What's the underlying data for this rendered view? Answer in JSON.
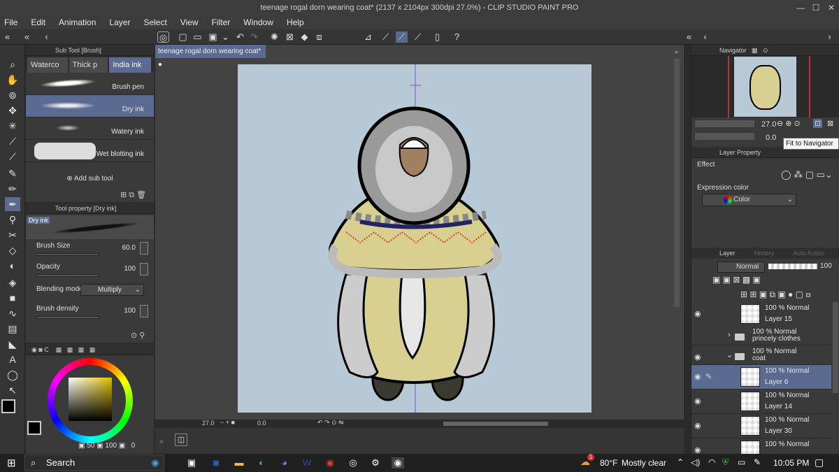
{
  "title": "teenage rogal dorn wearing coat* (2137 x 2104px 300dpi 27.0%) - CLIP STUDIO PAINT PRO",
  "window_controls": [
    "—",
    "☐",
    "✕"
  ],
  "menu": [
    "File",
    "Edit",
    "Animation",
    "Layer",
    "Select",
    "View",
    "Filter",
    "Window",
    "Help"
  ],
  "subtool": {
    "header": "Sub Tool [Brush]",
    "tabs": [
      "Waterco",
      "Thick p",
      "India ink"
    ],
    "brushes": [
      {
        "label": "Brush pen",
        "selected": false
      },
      {
        "label": "Dry ink",
        "selected": true
      },
      {
        "label": "Watery ink",
        "selected": false
      },
      {
        "label": "Wet blotting ink",
        "selected": false
      }
    ],
    "add_label": "Add sub tool"
  },
  "toolprop": {
    "header": "Tool property [Dry ink]",
    "preview_label": "Dry ink",
    "brush_size_label": "Brush Size",
    "brush_size_value": "60.0",
    "opacity_label": "Opacity",
    "opacity_value": "100",
    "blend_label": "Blending mode",
    "blend_value": "Multiply",
    "density_label": "Brush density",
    "density_value": "100"
  },
  "color": {
    "header_tab": "C",
    "bottom_values": [
      "50",
      "100",
      "0"
    ],
    "main": "#000000",
    "sub": "#f4e0e0"
  },
  "document": {
    "tab_label": "teenage rogal dorn wearing coat*",
    "zoom": "27.0",
    "angle": "0.0",
    "canvas_bg": "#b8c9d6"
  },
  "navigator": {
    "header": "Navigator",
    "zoom": "27.0",
    "angle": "0.0",
    "tooltip": "Fit to Navigator"
  },
  "layer_property": {
    "header": "Layer Property",
    "effect_label": "Effect",
    "expression_label": "Expression color",
    "expression_value": "Color"
  },
  "layer_panel": {
    "tabs": [
      "Layer",
      "History",
      "Auto Action"
    ],
    "blend_mode": "Normal",
    "opacity": "100",
    "layers": [
      {
        "mode": "100 % Normal",
        "name": "Layer 15",
        "type": "layer",
        "selected": false
      },
      {
        "mode": "100 % Normal",
        "name": "princely clothes",
        "type": "folder",
        "selected": false
      },
      {
        "mode": "100 % Normal",
        "name": "coat",
        "type": "folder",
        "selected": false
      },
      {
        "mode": "100 % Normal",
        "name": "Layer 6",
        "type": "layer",
        "selected": true
      },
      {
        "mode": "100 % Normal",
        "name": "Layer 14",
        "type": "layer",
        "selected": false
      },
      {
        "mode": "100 % Normal",
        "name": "Layer 30",
        "type": "layer",
        "selected": false
      },
      {
        "mode": "100 % Normal",
        "name": "",
        "type": "layer",
        "selected": false
      }
    ]
  },
  "taskbar": {
    "search": "Search",
    "weather_temp": "80°F",
    "weather_text": "Mostly clear",
    "time": "10:05 PM",
    "weather_badge": "1"
  }
}
